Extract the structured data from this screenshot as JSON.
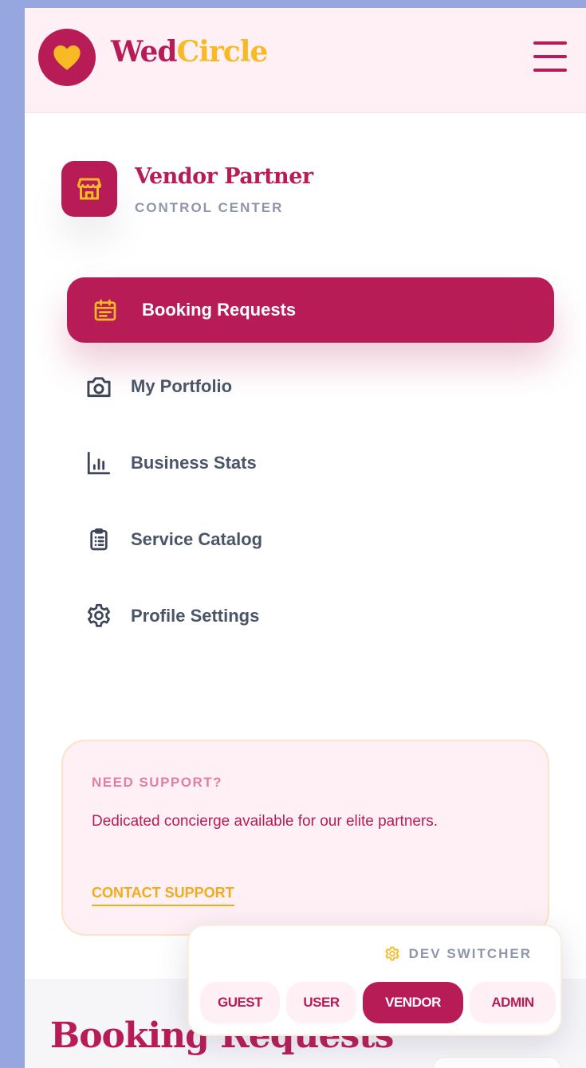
{
  "header": {
    "brand_part1": "Wed",
    "brand_part2": "Circle",
    "logo_icon": "heart-icon",
    "menu_icon": "hamburger-menu-icon"
  },
  "sidebar": {
    "vendor_title": "Vendor Partner",
    "vendor_subtitle": "CONTROL CENTER",
    "vendor_icon": "store-icon",
    "items": [
      {
        "label": "Booking Requests",
        "icon": "calendar-icon",
        "active": true
      },
      {
        "label": "My Portfolio",
        "icon": "camera-icon",
        "active": false
      },
      {
        "label": "Business Stats",
        "icon": "bar-chart-icon",
        "active": false
      },
      {
        "label": "Service Catalog",
        "icon": "clipboard-list-icon",
        "active": false
      },
      {
        "label": "Profile Settings",
        "icon": "gear-icon",
        "active": false
      }
    ]
  },
  "support": {
    "heading": "NEED SUPPORT?",
    "text": "Dedicated concierge available for our elite partners.",
    "link": "CONTACT SUPPORT"
  },
  "main": {
    "page_title": "Booking Requests"
  },
  "dev_switcher": {
    "title": "DEV SWITCHER",
    "icon": "gear-icon",
    "options": [
      "GUEST",
      "USER",
      "VENDOR",
      "ADMIN"
    ],
    "selected": "VENDOR"
  },
  "colors": {
    "primary": "#b81c56",
    "accent": "#f7b924",
    "page_background": "#95a7de",
    "header_background": "#fff0f5",
    "muted_text": "#8f96ab"
  }
}
